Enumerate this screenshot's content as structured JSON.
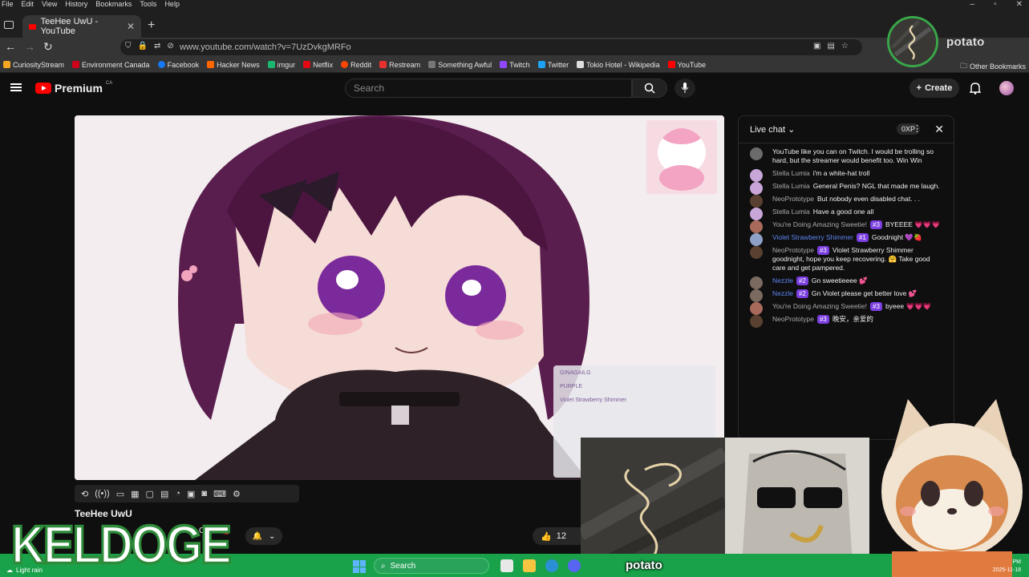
{
  "menu": [
    "File",
    "Edit",
    "View",
    "History",
    "Bookmarks",
    "Tools",
    "Help"
  ],
  "tab": {
    "title": "TeeHee UwU - YouTube"
  },
  "address": {
    "url": "www.youtube.com/watch?v=7UzDvkgMRFo"
  },
  "profile": {
    "name": "potato"
  },
  "bookmarks": [
    {
      "label": "CuriosityStream",
      "color": "#f5a623"
    },
    {
      "label": "Environment Canada",
      "color": "#d0021b"
    },
    {
      "label": "Facebook",
      "color": "#1877f2"
    },
    {
      "label": "Hacker News",
      "color": "#ff6600"
    },
    {
      "label": "imgur",
      "color": "#1bb76e"
    },
    {
      "label": "Netflix",
      "color": "#e50914"
    },
    {
      "label": "Reddit",
      "color": "#ff4500"
    },
    {
      "label": "Restream",
      "color": "#e8312f"
    },
    {
      "label": "Something Awful",
      "color": "#777777"
    },
    {
      "label": "Twitch",
      "color": "#9146ff"
    },
    {
      "label": "Twitter",
      "color": "#1da1f2"
    },
    {
      "label": "Tokio Hotel - Wikipedia",
      "color": "#dddddd"
    },
    {
      "label": "YouTube",
      "color": "#ff0000"
    }
  ],
  "bookmarks_other": "Other Bookmarks",
  "yt": {
    "logo_text": "Premium",
    "country": "CA",
    "search_placeholder": "Search",
    "create_label": "Create"
  },
  "video": {
    "channel": "TeeHee UwU",
    "cake": "Cake",
    "likes": "12",
    "overlay_chat": [
      "GINAGAILG",
      "PURPLE",
      "Violet Strawberry Shimmer"
    ]
  },
  "chat": {
    "title": "Live chat",
    "xp": "0XP",
    "messages": [
      {
        "author": "",
        "text": "YouTube like you can on Twitch. I would be trolling so hard, but the streamer would benefit too. Win Win",
        "badge": "",
        "mod": false,
        "avatar": "#6b6b6b"
      },
      {
        "author": "Stella Lumia",
        "text": "i'm a white-hat troll",
        "badge": "",
        "mod": false,
        "avatar": "#c9a6d8"
      },
      {
        "author": "Stella Lumia",
        "text": "General Penis? NGL that made me laugh.",
        "badge": "",
        "mod": false,
        "avatar": "#c9a6d8"
      },
      {
        "author": "NeoPrototype",
        "text": "But nobody even disabled chat. . .",
        "badge": "",
        "mod": false,
        "avatar": "#5a4030"
      },
      {
        "author": "Stella Lumia",
        "text": "Have a good one all",
        "badge": "",
        "mod": false,
        "avatar": "#c9a6d8"
      },
      {
        "author": "You're Doing Amazing Sweetie!",
        "text": "BYEEEE 💗💗💗",
        "badge": "#3",
        "mod": false,
        "avatar": "#a86a5a"
      },
      {
        "author": "Violet Strawberry Shimmer",
        "text": "Goodnight 💜🍓",
        "badge": "#1",
        "mod": true,
        "avatar": "#8fa0c8"
      },
      {
        "author": "NeoPrototype",
        "text": "Violet Strawberry Shimmer goodnight, hope you keep recovering. 🤗 Take good care and get pampered.",
        "badge": "#3",
        "mod": false,
        "avatar": "#5a4030"
      },
      {
        "author": "Nezzle",
        "text": "Gn sweetieeee 💕",
        "badge": "#2",
        "mod": true,
        "avatar": "#7a6a60"
      },
      {
        "author": "Nezzle",
        "text": "Gn Violet please get better love 💕",
        "badge": "#2",
        "mod": true,
        "avatar": "#7a6a60"
      },
      {
        "author": "You're Doing Amazing Sweetie!",
        "text": "byeee 💗💗💗",
        "badge": "#3",
        "mod": false,
        "avatar": "#a86a5a"
      },
      {
        "author": "NeoPrototype",
        "text": "晚安，亲爱的",
        "badge": "#3",
        "mod": false,
        "avatar": "#5a4030"
      }
    ]
  },
  "overlay": {
    "caption": "potato",
    "watermark": "KELDOGE"
  },
  "taskbar": {
    "weather": "Light rain",
    "search": "Search",
    "time": "PM",
    "date": "2025-11-18"
  },
  "colors": {
    "accent": "#ff0000",
    "taskbar": "#1aa24a",
    "badge": "#7b3ee0"
  }
}
